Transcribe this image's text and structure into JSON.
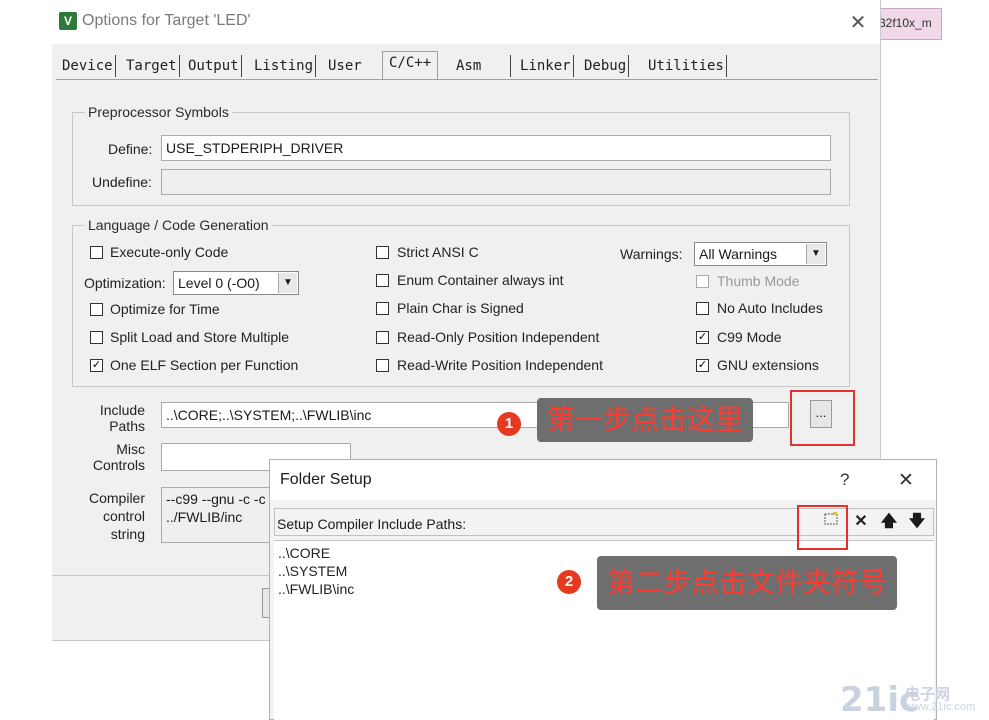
{
  "dialog": {
    "title": "Options for Target 'LED'",
    "app_icon": "V",
    "close_glyph": "✕",
    "tabs": [
      "Device",
      "Target",
      "Output",
      "Listing",
      "User",
      "C/C++",
      "Asm",
      "Linker",
      "Debug",
      "Utilities"
    ],
    "active_tab": "C/C++"
  },
  "preprocessor": {
    "group_title": "Preprocessor Symbols",
    "define_label": "Define:",
    "define_value": "USE_STDPERIPH_DRIVER",
    "undefine_label": "Undefine:",
    "undefine_value": ""
  },
  "language": {
    "group_title": "Language / Code Generation",
    "execute_only": {
      "label": "Execute-only Code",
      "checked": false
    },
    "optimization_label": "Optimization:",
    "optimization_value": "Level 0 (-O0)",
    "optimize_time": {
      "label": "Optimize for Time",
      "checked": false
    },
    "split_load": {
      "label": "Split Load and Store Multiple",
      "checked": false
    },
    "one_elf": {
      "label": "One ELF Section per Function",
      "checked": true
    },
    "strict_ansi": {
      "label": "Strict ANSI C",
      "checked": false
    },
    "enum_container": {
      "label": "Enum Container always int",
      "checked": false
    },
    "plain_char": {
      "label": "Plain Char is Signed",
      "checked": false
    },
    "ro_pi": {
      "label": "Read-Only Position Independent",
      "checked": false
    },
    "rw_pi": {
      "label": "Read-Write Position Independent",
      "checked": false
    },
    "warnings_label": "Warnings:",
    "warnings_value": "All Warnings",
    "thumb_mode": {
      "label": "Thumb Mode",
      "checked": false
    },
    "no_auto_includes": {
      "label": "No Auto Includes",
      "checked": false
    },
    "c99_mode": {
      "label": "C99 Mode",
      "checked": true
    },
    "gnu_ext": {
      "label": "GNU extensions",
      "checked": true
    }
  },
  "include": {
    "label_line1": "Include",
    "label_line2": "Paths",
    "value": "..\\CORE;..\\SYSTEM;..\\FWLIB\\inc",
    "browse_label": "..."
  },
  "misc": {
    "label_line1": "Misc",
    "label_line2": "Controls",
    "value": ""
  },
  "compiler": {
    "label_line1": "Compiler",
    "label_line2": "control",
    "label_line3": "string",
    "line1": "--c99 --gnu -c -c",
    "line2": "../FWLIB/inc"
  },
  "annotations": {
    "step1_badge": "1",
    "step1_text": "第一步点击这里",
    "step2_badge": "2",
    "step2_text": "第二步点击文件夹符号",
    "accent_color": "#e53030"
  },
  "folder_setup": {
    "title": "Folder Setup",
    "help_glyph": "?",
    "close_glyph": "✕",
    "section_label": "Setup Compiler Include Paths:",
    "paths": [
      "..\\CORE",
      "..\\SYSTEM",
      "..\\FWLIB\\inc"
    ],
    "toolbar_icons": [
      "new-folder-icon",
      "delete-icon",
      "move-up-icon",
      "move-down-icon"
    ]
  },
  "background": {
    "strip_text": "32f10x_m"
  },
  "watermark": {
    "main": "21ic",
    "cn": "电子网",
    "url": "www.21ic.com"
  }
}
